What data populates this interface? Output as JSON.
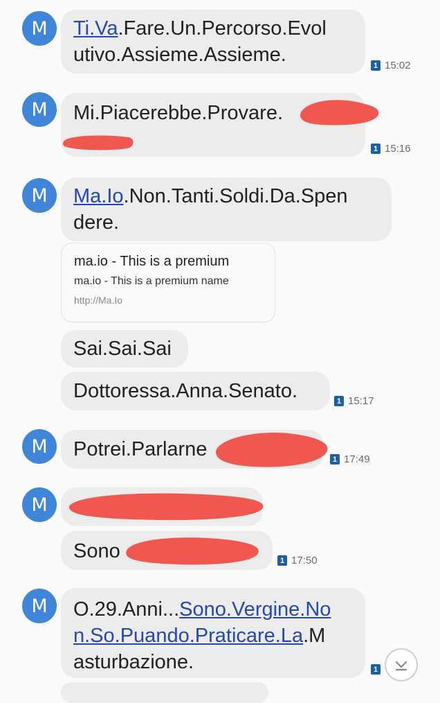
{
  "avatar_letter": "M",
  "sim_badge": "1",
  "messages": [
    {
      "lines": [
        [
          "Ti.Va",
          ".Fare.Un.Percorso.Evol"
        ],
        [
          "utivo.Assieme.Assieme."
        ]
      ],
      "time": "15:02"
    },
    {
      "lines": [
        [
          "Mi.Piacerebbe.Provare."
        ],
        [
          ""
        ]
      ],
      "time": "15:16"
    },
    {
      "lines": [
        [
          "Ma.Io",
          ".Non.Tanti.Soldi.Da.Spen"
        ],
        [
          "dere."
        ]
      ]
    },
    {
      "lines": [
        [
          "Sai.Sai.Sai"
        ]
      ]
    },
    {
      "lines": [
        [
          "Dottoressa.Anna.Senato."
        ]
      ],
      "time": "15:17"
    },
    {
      "lines": [
        [
          "Potrei.Parlarne"
        ]
      ],
      "time": "17:49"
    },
    {
      "lines": [
        [
          ""
        ]
      ]
    },
    {
      "lines": [
        [
          "Sono"
        ]
      ],
      "time": "17:50"
    },
    {
      "lines": [
        [
          "O.29.Anni...",
          "Sono.Vergine.No"
        ],
        [
          "n.So.Puando.Praticare.La",
          ".M"
        ],
        [
          "asturbazione."
        ]
      ]
    }
  ],
  "link_preview": {
    "title": "ma.io - This is a premium",
    "description": "ma.io - This is a premium name",
    "url": "http://Ma.Io"
  },
  "scroll_icon": "chevron-down-icon"
}
